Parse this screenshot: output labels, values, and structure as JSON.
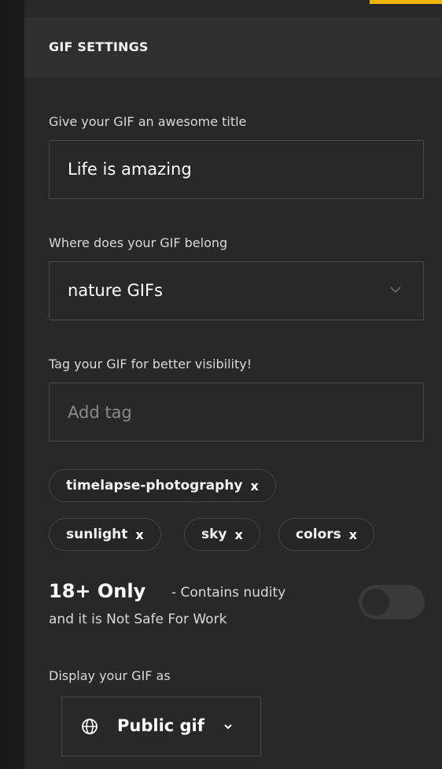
{
  "header": {
    "title": "GIF SETTINGS"
  },
  "title_field": {
    "label": "Give your GIF an awesome title",
    "value": "Life is amazing"
  },
  "category_field": {
    "label": "Where does your GIF belong",
    "selected": "nature GIFs",
    "icon": "chevron-down-icon"
  },
  "tag_field": {
    "label": "Tag your GIF for better visibility!",
    "placeholder": "Add tag"
  },
  "tags": [
    {
      "label": "timelapse-photography",
      "remove": "x"
    },
    {
      "label": "sunlight",
      "remove": "x"
    },
    {
      "label": "sky",
      "remove": "x"
    },
    {
      "label": "colors",
      "remove": "x"
    }
  ],
  "nsfw": {
    "title": "18+ Only",
    "description_line1": "- Contains nudity",
    "description_line2": "and it is Not Safe For Work",
    "toggle_on": false
  },
  "display": {
    "label": "Display your GIF as",
    "selected": "Public gif",
    "icon": "globe-icon",
    "caret_icon": "caret-down-icon"
  },
  "colors": {
    "accent": "#f2b705",
    "panel_bg": "#282828",
    "header_bg": "#2f2f2f"
  }
}
